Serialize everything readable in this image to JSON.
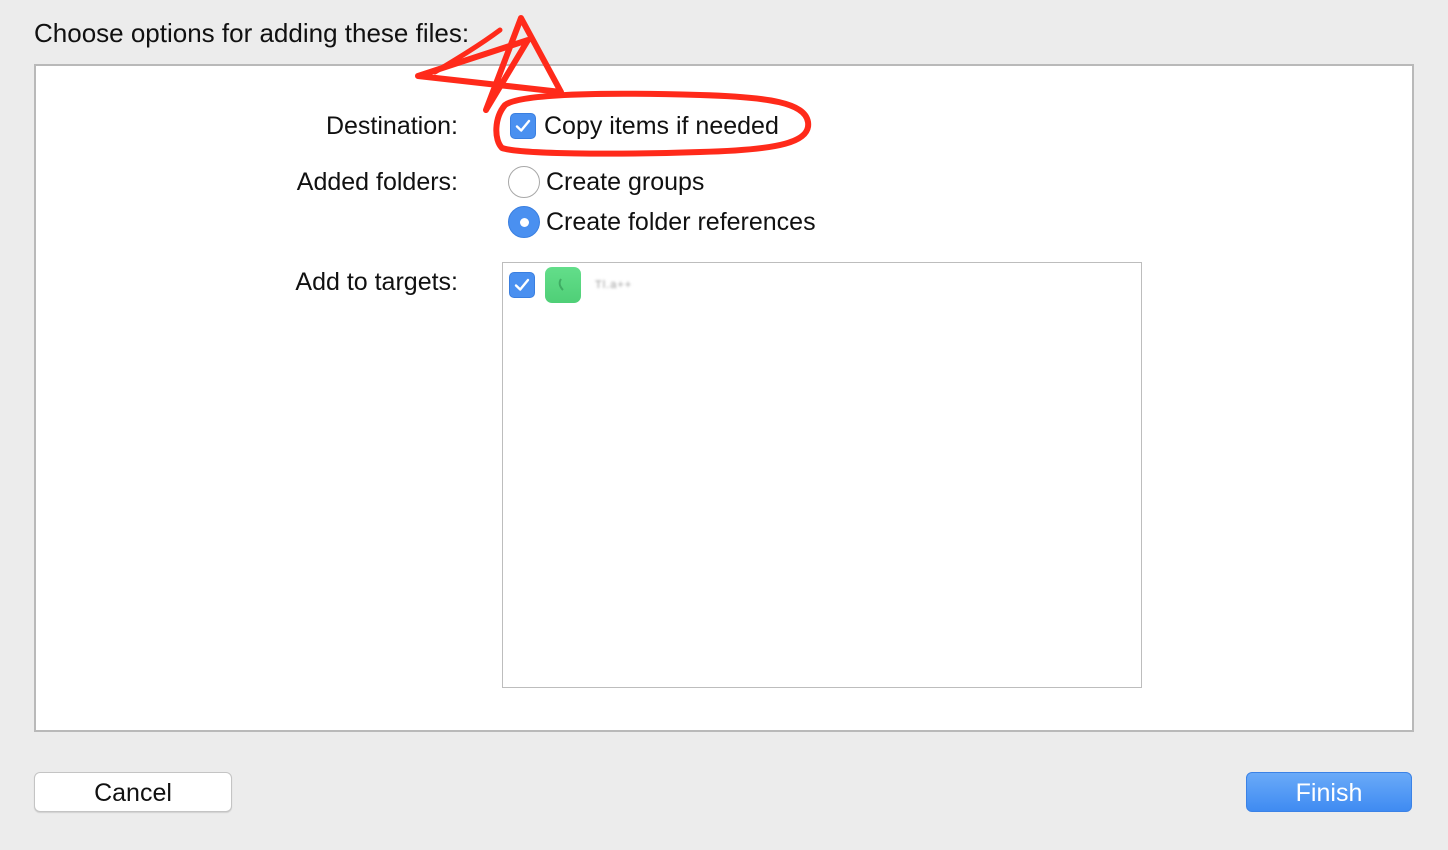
{
  "dialog": {
    "heading": "Choose options for adding these files:"
  },
  "destination": {
    "label": "Destination:",
    "copy_items_label": "Copy items if needed",
    "copy_items_checked": true
  },
  "added_folders": {
    "label": "Added folders:",
    "options": [
      {
        "label": "Create groups",
        "selected": false
      },
      {
        "label": "Create folder references",
        "selected": true
      }
    ]
  },
  "targets": {
    "label": "Add to targets:",
    "items": [
      {
        "name": "Tl.a++",
        "checked": true,
        "icon": "app-icon"
      }
    ]
  },
  "buttons": {
    "cancel_label": "Cancel",
    "finish_label": "Finish"
  },
  "colors": {
    "accent": "#4a90f0",
    "annotation": "#ff2a1a",
    "app_icon": "#5ad57f"
  }
}
